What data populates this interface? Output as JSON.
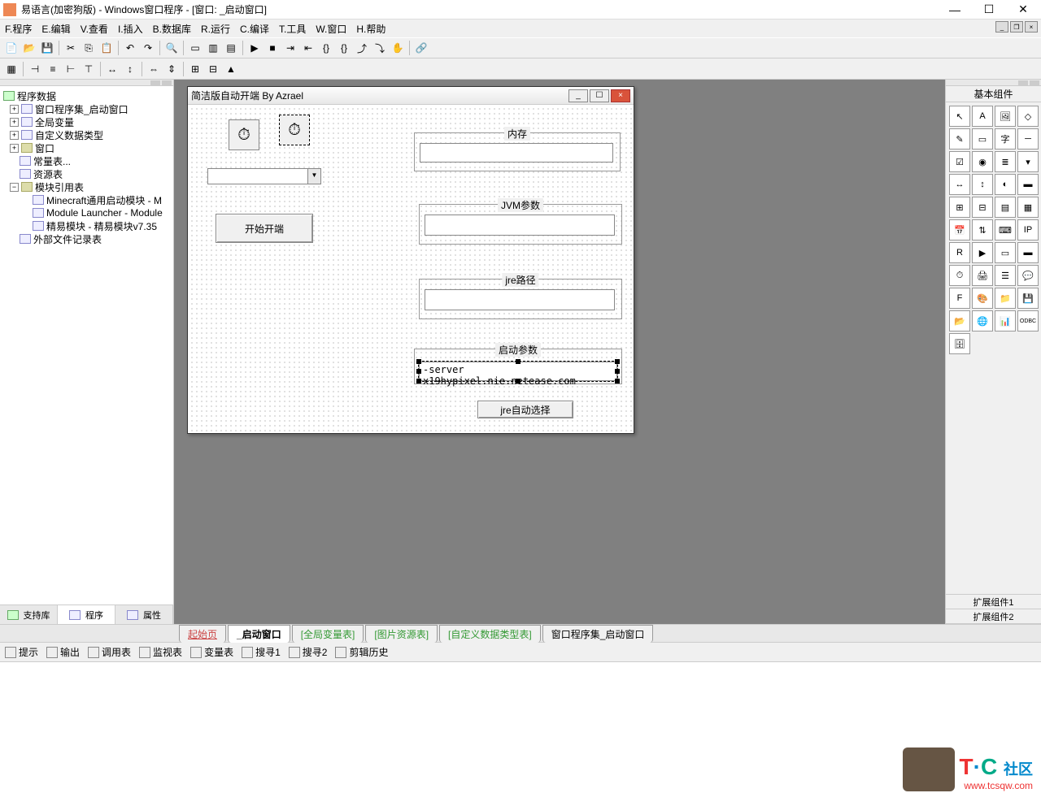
{
  "titlebar": {
    "text": "易语言(加密狗版) - Windows窗口程序 - [窗口: _启动窗口]"
  },
  "menu": {
    "program": "F.程序",
    "edit": "E.编辑",
    "view": "V.查看",
    "insert": "I.插入",
    "database": "B.数据库",
    "run": "R.运行",
    "compile": "C.编译",
    "tools": "T.工具",
    "window": "W.窗口",
    "help": "H.帮助"
  },
  "tree": {
    "root": "程序数据",
    "items": [
      "窗口程序集_启动窗口",
      "全局变量",
      "自定义数据类型",
      "窗口",
      "常量表...",
      "资源表",
      "模块引用表"
    ],
    "modules": [
      "Minecraft通用启动模块 - M",
      "Module Launcher - Module",
      "精易模块 - 精易模块v7.35"
    ],
    "ext": "外部文件记录表"
  },
  "left_tabs": {
    "support": "支持库",
    "program": "程序",
    "props": "属性"
  },
  "form": {
    "title": "简洁版自动开端 By Azrael",
    "labels": {
      "memory": "内存",
      "jvm": "JVM参数",
      "jre": "jre路径",
      "launch": "启动参数"
    },
    "start_btn": "开始开端",
    "jre_btn": "jre自动选择",
    "launch_value": "-server x19hypixel.nie.netease.com"
  },
  "right_panel": {
    "title": "基本组件",
    "ext1": "扩展组件1",
    "ext2": "扩展组件2"
  },
  "bottom_tabs": {
    "start": "起始页",
    "launch": "_启动窗口",
    "global": "[全局变量表]",
    "image": "[图片资源表]",
    "custom": "[自定义数据类型表]",
    "winset": "窗口程序集_启动窗口"
  },
  "bottom2": {
    "tip": "提示",
    "output": "输出",
    "call": "调用表",
    "watch": "监视表",
    "var": "变量表",
    "search1": "搜寻1",
    "search2": "搜寻2",
    "clip": "剪辑历史"
  },
  "watermark": {
    "t": "T",
    "c": "C",
    "s": "社区",
    "url": "www.tcsqw.com"
  }
}
